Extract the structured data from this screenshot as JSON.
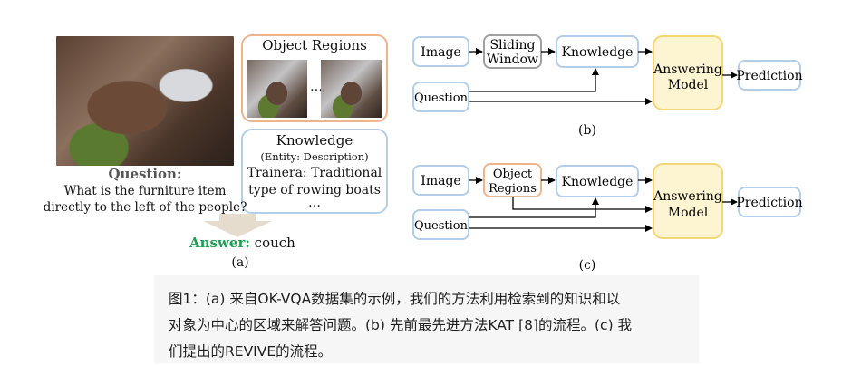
{
  "panel_a": {
    "object_regions_title": "Object Regions",
    "ellipsis": "…",
    "knowledge_title": "Knowledge",
    "knowledge_subtitle": "(Entity: Description)",
    "knowledge_line1": "Trainera: Traditional",
    "knowledge_line2": "type of rowing boats",
    "knowledge_ellipsis": "…",
    "question_label": "Question:",
    "question_line1": "What is the furniture item",
    "question_line2": "directly to the left of the people?",
    "answer_label": "Answer:",
    "answer_value": "couch",
    "label": "(a)"
  },
  "panel_b": {
    "image": "Image",
    "sliding_line1": "Sliding",
    "sliding_line2": "Window",
    "knowledge": "Knowledge",
    "question": "Question",
    "answering_line1": "Answering",
    "answering_line2": "Model",
    "prediction": "Prediction",
    "label": "(b)"
  },
  "panel_c": {
    "image": "Image",
    "object_line1": "Object",
    "object_line2": "Regions",
    "knowledge": "Knowledge",
    "question": "Question",
    "answering_line1": "Answering",
    "answering_line2": "Model",
    "prediction": "Prediction",
    "label": "(c)"
  },
  "caption": {
    "line1": "图1：(a) 来自OK-VQA数据集的示例，我们的方法利用检索到的知识和以",
    "line2": "对象为中心的区域来解答问题。(b) 先前最先进方法KAT [8]的流程。(c) 我",
    "line3": "们提出的REVIVE的流程。"
  },
  "colors": {
    "blue_border": "#b4cde8",
    "orange_border": "#eeb48d",
    "gray_border": "#a0a0a0",
    "gold_border": "#f3d775",
    "gold_fill": "#fdf5d2",
    "answer_green": "#1f9f55",
    "caption_bg": "#f6f6f6",
    "arrow_fill": "#e5dccd"
  }
}
